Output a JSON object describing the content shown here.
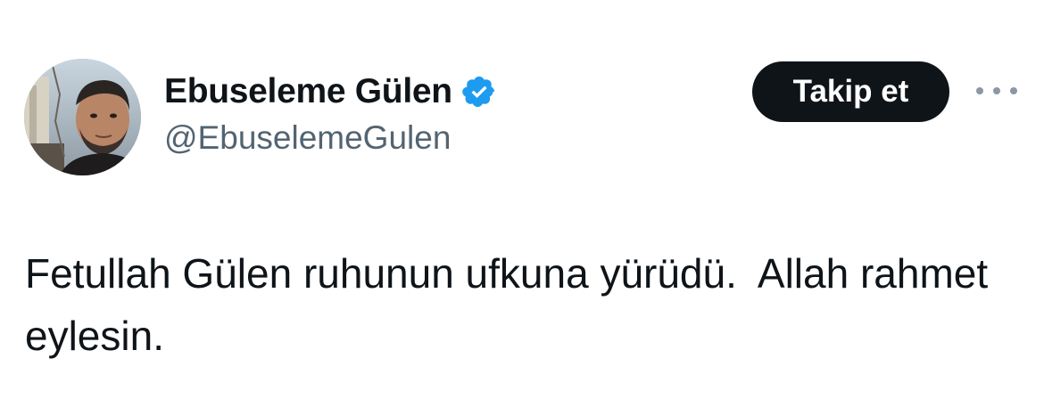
{
  "author": {
    "display_name": "Ebuseleme Gülen",
    "handle": "@EbuselemeGulen",
    "verified": true,
    "verified_color": "#1d9bf0"
  },
  "actions": {
    "follow_label": "Takip et",
    "more_icon": "more-horizontal-icon"
  },
  "tweet": {
    "text": "Fetullah Gülen ruhunun ufkuna yürüdü.  Allah rahmet eylesin."
  },
  "colors": {
    "primary_text": "#0f1419",
    "secondary_text": "#536471",
    "button_bg": "#0f1419",
    "button_text": "#ffffff"
  }
}
